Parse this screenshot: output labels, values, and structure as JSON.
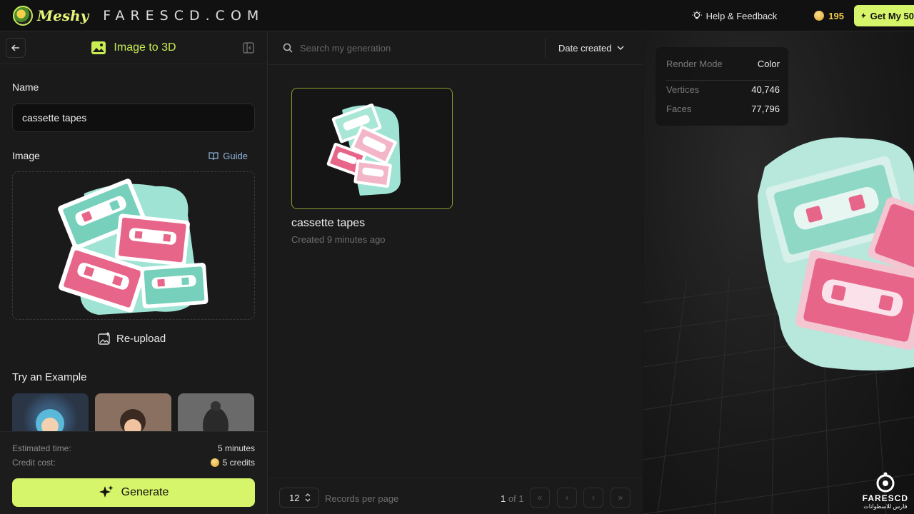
{
  "topbar": {
    "logo_text": "Meshy",
    "brand": "FARESCD.COM",
    "help_label": "Help & Feedback",
    "credits": "195",
    "get_label": "Get My 50"
  },
  "left": {
    "title": "Image to 3D",
    "name_label": "Name",
    "name_value": "cassette tapes",
    "image_label": "Image",
    "guide_label": "Guide",
    "reupload_label": "Re-upload",
    "examples_label": "Try an Example",
    "est_time_label": "Estimated time:",
    "est_time_value": "5 minutes",
    "credit_label": "Credit cost:",
    "credit_value": "5 credits",
    "generate_label": "Generate"
  },
  "middle": {
    "search_placeholder": "Search my generation",
    "sort_label": "Date created",
    "card": {
      "title": "cassette tapes",
      "subtitle": "Created 9 minutes ago"
    },
    "pager": {
      "per_page": "12",
      "per_page_label": "Records per page",
      "page_current": "1",
      "page_of": "of 1"
    }
  },
  "viewer": {
    "render_mode_label": "Render Mode",
    "render_mode_value": "Color",
    "vertices_label": "Vertices",
    "vertices_value": "40,746",
    "faces_label": "Faces",
    "faces_value": "77,796",
    "watermark": "FARESCD",
    "watermark_sub": "فارس للاسطوانات"
  },
  "colors": {
    "accent": "#d7f56a",
    "mint": "#9fe3d4",
    "pink": "#e8658a"
  }
}
